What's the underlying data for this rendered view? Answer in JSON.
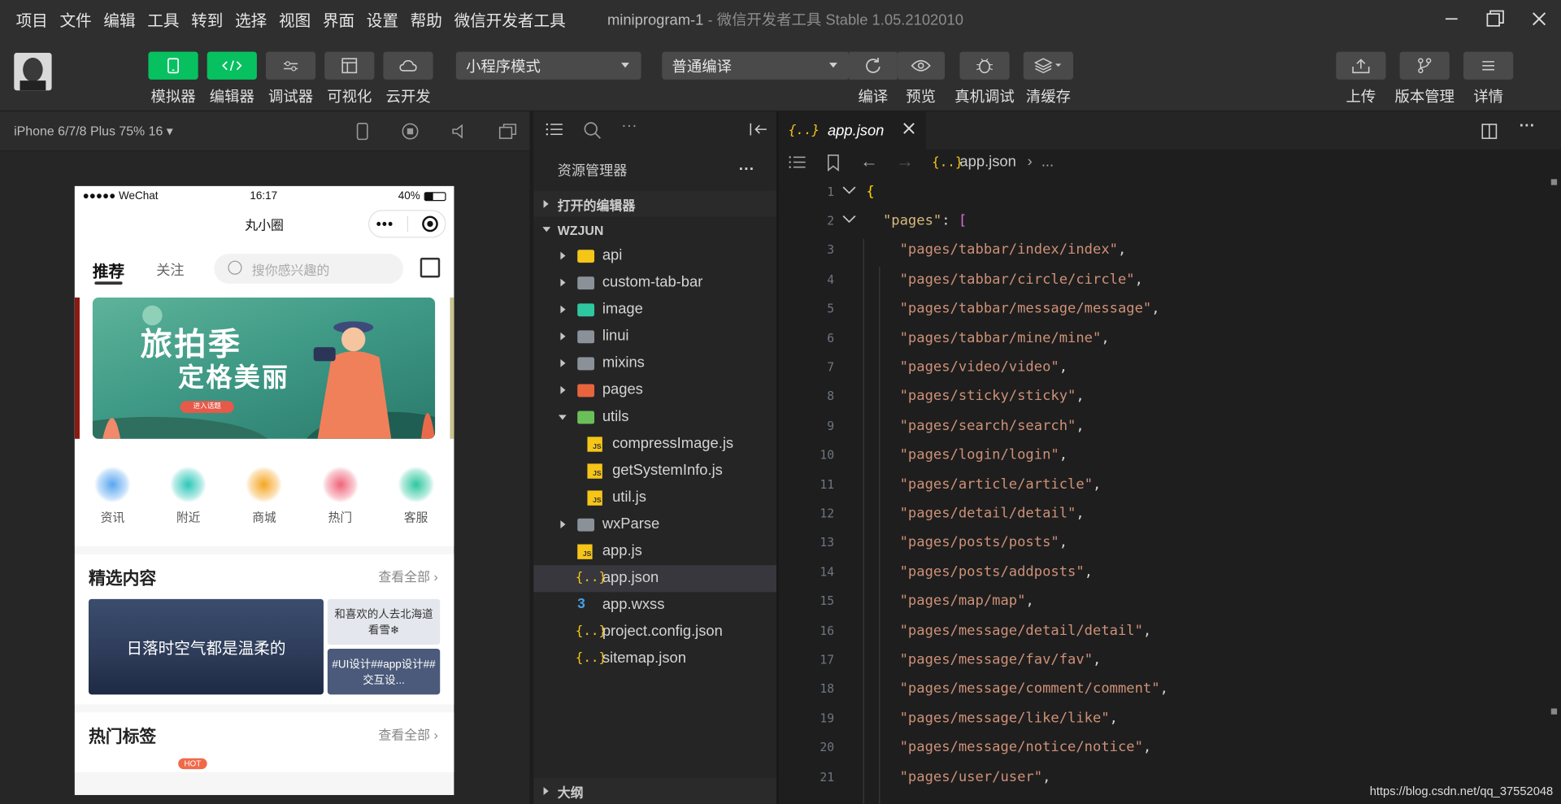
{
  "menu": [
    "项目",
    "文件",
    "编辑",
    "工具",
    "转到",
    "选择",
    "视图",
    "界面",
    "设置",
    "帮助",
    "微信开发者工具"
  ],
  "window": {
    "project": "miniprogram-1",
    "separator": " - ",
    "app": "微信开发者工具 Stable 1.05.2102010"
  },
  "toolbar": {
    "left_buttons": [
      "模拟器",
      "编辑器",
      "调试器",
      "可视化",
      "云开发"
    ],
    "mode_select": "小程序模式",
    "compile_select": "普通编译",
    "center_buttons": [
      "编译",
      "预览",
      "真机调试",
      "清缓存"
    ],
    "right_buttons": [
      "上传",
      "版本管理",
      "详情"
    ]
  },
  "simulator": {
    "device": "iPhone 6/7/8 Plus 75% 16",
    "status": {
      "carrier": "●●●●● WeChat",
      "time": "16:17",
      "battery": "40%"
    },
    "nav_title": "丸小圈",
    "tabs": {
      "recommend": "推荐",
      "follow": "关注"
    },
    "search_placeholder": "搜你感兴趣的",
    "banner": {
      "line1": "旅拍季",
      "line2": "定格美丽",
      "button": "进入话题"
    },
    "icons": [
      {
        "label": "资讯",
        "color": "#58a6f0"
      },
      {
        "label": "附近",
        "color": "#2ec7b8"
      },
      {
        "label": "商城",
        "color": "#f5a623"
      },
      {
        "label": "热门",
        "color": "#f0637a"
      },
      {
        "label": "客服",
        "color": "#2ec7a0"
      }
    ],
    "featured": {
      "title": "精选内容",
      "more": "查看全部",
      "big": "日落时空气都是温柔的",
      "side_a": "和喜欢的人去北海道看雪❄",
      "side_b": "#UI设计##app设计##交互设..."
    },
    "hot": {
      "title": "热门标签",
      "more": "查看全部",
      "badge": "HOT"
    }
  },
  "explorer": {
    "title": "资源管理器",
    "open_editors": "打开的编辑器",
    "project": "WZJUN",
    "items": [
      {
        "name": "api",
        "type": "folder",
        "color": "#f5c518",
        "open": false,
        "depth": 1
      },
      {
        "name": "custom-tab-bar",
        "type": "folder",
        "color": "#8a9199",
        "open": false,
        "depth": 1
      },
      {
        "name": "image",
        "type": "folder",
        "color": "#2ec7a0",
        "open": false,
        "depth": 1
      },
      {
        "name": "linui",
        "type": "folder",
        "color": "#8a9199",
        "open": false,
        "depth": 1
      },
      {
        "name": "mixins",
        "type": "folder",
        "color": "#8a9199",
        "open": false,
        "depth": 1
      },
      {
        "name": "pages",
        "type": "folder",
        "color": "#e8643c",
        "open": false,
        "depth": 1
      },
      {
        "name": "utils",
        "type": "folder",
        "color": "#6bbf59",
        "open": true,
        "depth": 1
      },
      {
        "name": "compressImage.js",
        "type": "js",
        "depth": 2
      },
      {
        "name": "getSystemInfo.js",
        "type": "js",
        "depth": 2
      },
      {
        "name": "util.js",
        "type": "js",
        "depth": 2
      },
      {
        "name": "wxParse",
        "type": "folder",
        "color": "#8a9199",
        "open": false,
        "depth": 1
      },
      {
        "name": "app.js",
        "type": "js",
        "depth": 1
      },
      {
        "name": "app.json",
        "type": "json",
        "depth": 1,
        "selected": true
      },
      {
        "name": "app.wxss",
        "type": "css",
        "depth": 1
      },
      {
        "name": "project.config.json",
        "type": "json",
        "depth": 1
      },
      {
        "name": "sitemap.json",
        "type": "json",
        "depth": 1
      }
    ],
    "outline": "大纲"
  },
  "editor": {
    "tab": "app.json",
    "breadcrumb": [
      "app.json",
      "..."
    ],
    "pages_key": "\"pages\"",
    "pages": [
      "pages/tabbar/index/index",
      "pages/tabbar/circle/circle",
      "pages/tabbar/message/message",
      "pages/tabbar/mine/mine",
      "pages/video/video",
      "pages/sticky/sticky",
      "pages/search/search",
      "pages/login/login",
      "pages/article/article",
      "pages/detail/detail",
      "pages/posts/posts",
      "pages/posts/addposts",
      "pages/map/map",
      "pages/message/detail/detail",
      "pages/message/fav/fav",
      "pages/message/comment/comment",
      "pages/message/like/like",
      "pages/message/notice/notice",
      "pages/user/user"
    ]
  },
  "watermark": "https://blog.csdn.net/qq_37552048"
}
